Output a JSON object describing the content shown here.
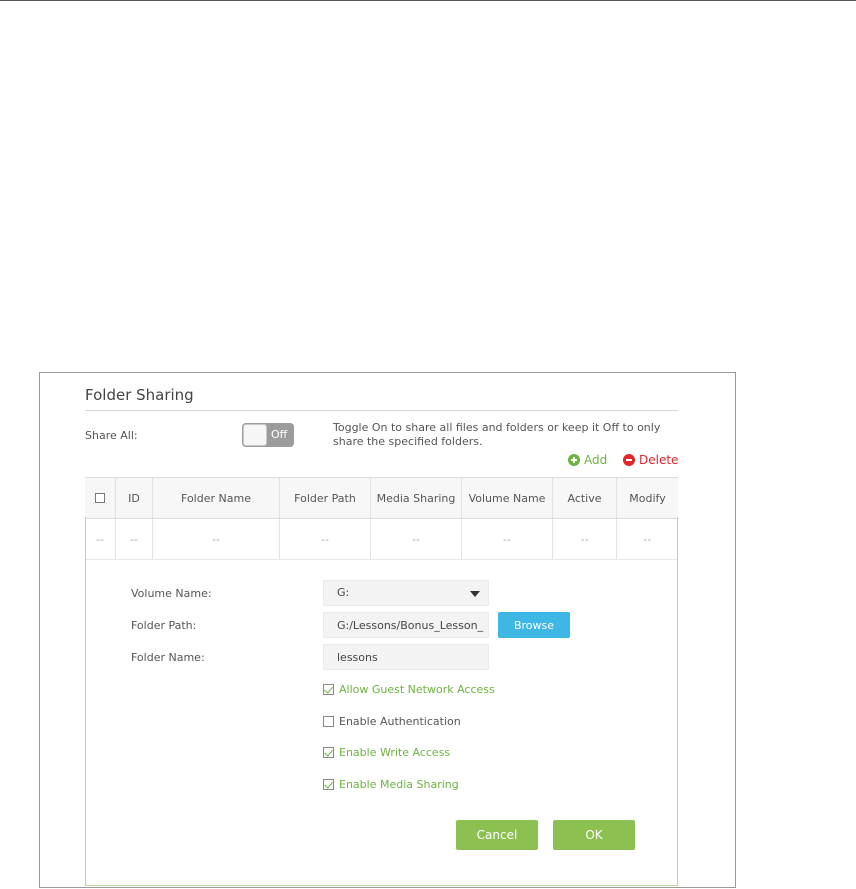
{
  "section": {
    "title": "Folder Sharing",
    "share_all_label": "Share All:",
    "toggle_state": "Off",
    "share_hint": "Toggle On to share all files and folders or keep it Off to only share the specified folders."
  },
  "actions": {
    "add": "Add",
    "delete": "Delete"
  },
  "table": {
    "headers": [
      "ID",
      "Folder Name",
      "Folder Path",
      "Media Sharing",
      "Volume Name",
      "Active",
      "Modify"
    ],
    "row": [
      "--",
      "--",
      "--",
      "--",
      "--",
      "--",
      "--",
      "--"
    ]
  },
  "form": {
    "volume_name_label": "Volume Name:",
    "volume_name_value": "G:",
    "folder_path_label": "Folder Path:",
    "folder_path_value": "G:/Lessons/Bonus_Lesson_",
    "browse_label": "Browse",
    "folder_name_label": "Folder Name:",
    "folder_name_value": "lessons",
    "options": [
      {
        "label": "Allow Guest Network Access",
        "checked": true
      },
      {
        "label": "Enable Authentication",
        "checked": false
      },
      {
        "label": "Enable Write Access",
        "checked": true
      },
      {
        "label": "Enable Media Sharing",
        "checked": true
      }
    ],
    "cancel_label": "Cancel",
    "ok_label": "OK"
  },
  "colors": {
    "accent_green": "#8cc152",
    "add_green": "#6cb33f",
    "delete_red": "#e1262c",
    "browse_blue": "#3fb7e5"
  }
}
